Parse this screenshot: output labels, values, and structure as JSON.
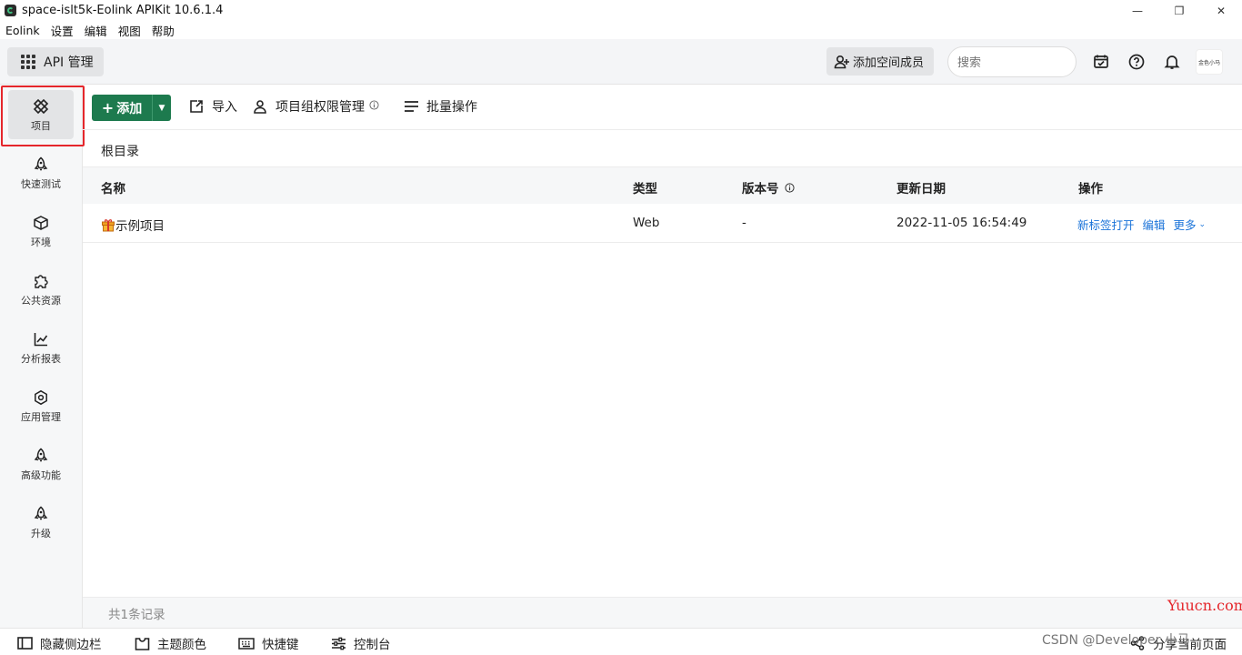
{
  "window": {
    "title": "space-islt5k-Eolink APIKit 10.6.1.4",
    "controls": [
      "—",
      "❐",
      "✕"
    ]
  },
  "menubar": [
    "Eolink",
    "设置",
    "编辑",
    "视图",
    "帮助"
  ],
  "topbar": {
    "module_label": "API 管理",
    "add_member_label": "添加空间成员",
    "search_placeholder": "搜索",
    "avatar_text": "金色小马"
  },
  "sidebar": {
    "items": [
      {
        "label": "项目",
        "icon": "project-icon",
        "active": true
      },
      {
        "label": "快速测试",
        "icon": "rocket-icon"
      },
      {
        "label": "环境",
        "icon": "cube-icon"
      },
      {
        "label": "公共资源",
        "icon": "puzzle-icon"
      },
      {
        "label": "分析报表",
        "icon": "chart-icon"
      },
      {
        "label": "应用管理",
        "icon": "gear-icon"
      },
      {
        "label": "高级功能",
        "icon": "rocket-icon"
      },
      {
        "label": "升级",
        "icon": "rocket-icon"
      }
    ]
  },
  "toolbar": {
    "add_label": "添加",
    "import_label": "导入",
    "permission_label": "项目组权限管理",
    "batch_label": "批量操作"
  },
  "breadcrumb": "根目录",
  "table": {
    "columns": {
      "name": "名称",
      "type": "类型",
      "version": "版本号",
      "updated": "更新日期",
      "actions": "操作"
    },
    "rows": [
      {
        "name": "示例项目",
        "type": "Web",
        "version": "-",
        "updated": "2022-11-05 16:54:49",
        "actions": {
          "open": "新标签打开",
          "edit": "编辑",
          "more": "更多"
        }
      }
    ]
  },
  "footer_count": "共1条记录",
  "bottombar": {
    "hide_sidebar": "隐藏侧边栏",
    "theme": "主题颜色",
    "shortcuts": "快捷键",
    "console": "控制台",
    "share": "分享当前页面"
  },
  "watermarks": {
    "site": "Yuucn.com",
    "csdn": "CSDN @Developer 小马"
  },
  "colors": {
    "primary": "#1d7a4e",
    "link": "#1a73d9",
    "highlight": "#e5262b"
  }
}
